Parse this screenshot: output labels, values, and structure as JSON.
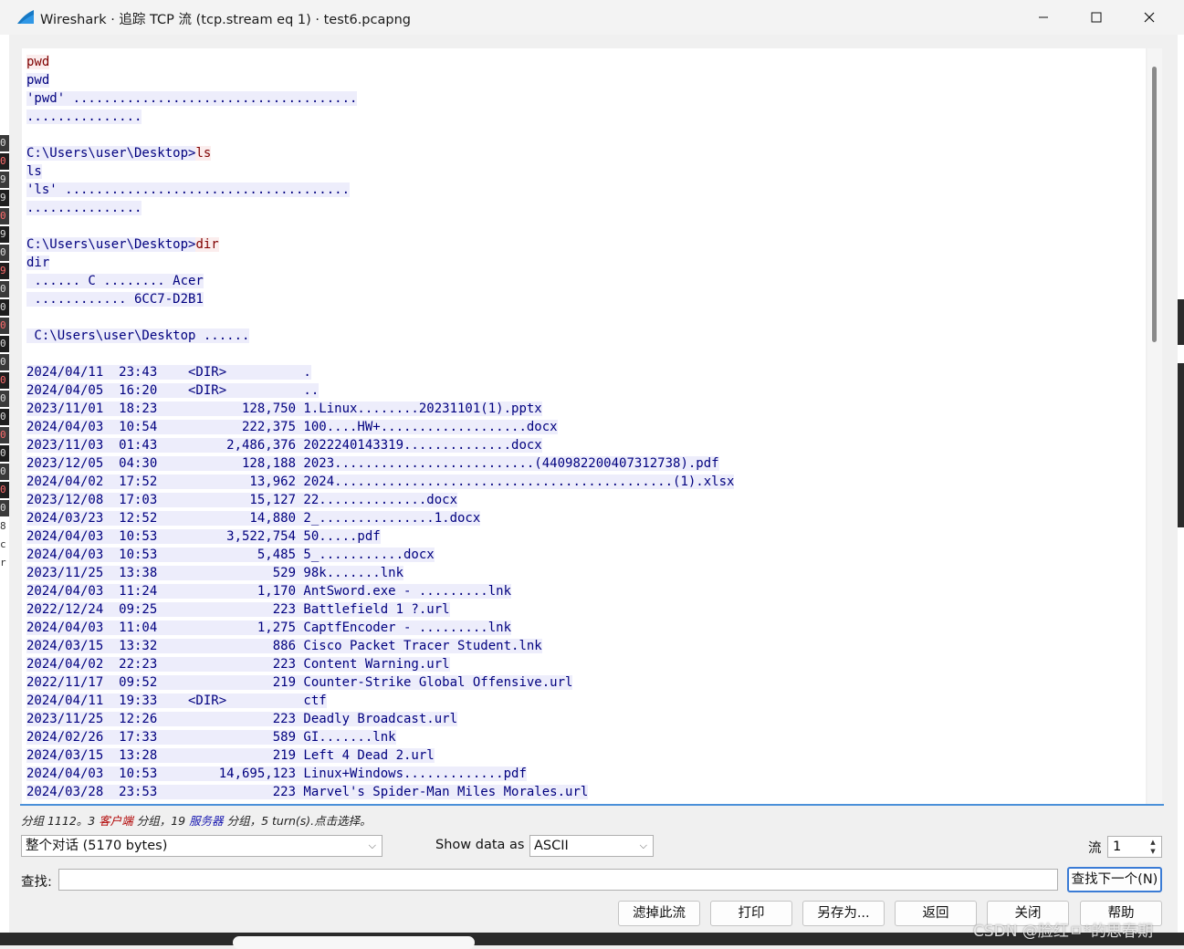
{
  "window": {
    "title": "Wireshark · 追踪 TCP 流 (tcp.stream eq 1) · test6.pcapng",
    "minimize_glyph": "—",
    "maximize_glyph": "☐",
    "close_glyph": "✕",
    "icon": "wireshark-fin-icon"
  },
  "colors": {
    "client_bg": "#fbeded",
    "client_fg": "#7f0000",
    "server_bg": "#ededfb",
    "server_fg": "#00007f",
    "focus": "#3a7bd5"
  },
  "stream_lines": [
    [
      {
        "d": "c",
        "t": "pwd"
      }
    ],
    [
      {
        "d": "s",
        "t": "pwd"
      }
    ],
    [
      {
        "d": "s",
        "t": "'pwd' ....................................."
      }
    ],
    [
      {
        "d": "s",
        "t": "..............."
      }
    ],
    [],
    [
      {
        "d": "s",
        "t": "C:\\Users\\user\\Desktop>"
      },
      {
        "d": "c",
        "t": "ls"
      }
    ],
    [
      {
        "d": "s",
        "t": "ls"
      }
    ],
    [
      {
        "d": "s",
        "t": "'ls' ....................................."
      }
    ],
    [
      {
        "d": "s",
        "t": "..............."
      }
    ],
    [],
    [
      {
        "d": "s",
        "t": "C:\\Users\\user\\Desktop>"
      },
      {
        "d": "c",
        "t": "dir"
      }
    ],
    [
      {
        "d": "s",
        "t": "dir"
      }
    ],
    [
      {
        "d": "s",
        "t": " ...... C ........ Acer"
      }
    ],
    [
      {
        "d": "s",
        "t": " ............ 6CC7-D2B1"
      }
    ],
    [],
    [
      {
        "d": "s",
        "t": " C:\\Users\\user\\Desktop ......"
      }
    ],
    [],
    [
      {
        "d": "s",
        "t": "2024/04/11  23:43    <DIR>          ."
      }
    ],
    [
      {
        "d": "s",
        "t": "2024/04/05  16:20    <DIR>          .."
      }
    ],
    [
      {
        "d": "s",
        "t": "2023/11/01  18:23           128,750 1.Linux........20231101(1).pptx"
      }
    ],
    [
      {
        "d": "s",
        "t": "2024/04/03  10:54           222,375 100....HW+...................docx"
      }
    ],
    [
      {
        "d": "s",
        "t": "2023/11/03  01:43         2,486,376 2022240143319..............docx"
      }
    ],
    [
      {
        "d": "s",
        "t": "2023/12/05  04:30           128,188 2023..........................(440982200407312738).pdf"
      }
    ],
    [
      {
        "d": "s",
        "t": "2024/04/02  17:52            13,962 2024............................................(1).xlsx"
      }
    ],
    [
      {
        "d": "s",
        "t": "2023/12/08  17:03            15,127 22..............docx"
      }
    ],
    [
      {
        "d": "s",
        "t": "2024/03/23  12:52            14,880 2_...............1.docx"
      }
    ],
    [
      {
        "d": "s",
        "t": "2024/04/03  10:53         3,522,754 50.....pdf"
      }
    ],
    [
      {
        "d": "s",
        "t": "2024/04/03  10:53             5,485 5_...........docx"
      }
    ],
    [
      {
        "d": "s",
        "t": "2023/11/25  13:38               529 98k.......lnk"
      }
    ],
    [
      {
        "d": "s",
        "t": "2024/04/03  11:24             1,170 AntSword.exe - .........lnk"
      }
    ],
    [
      {
        "d": "s",
        "t": "2022/12/24  09:25               223 Battlefield 1 ?.url"
      }
    ],
    [
      {
        "d": "s",
        "t": "2024/04/03  11:04             1,275 CaptfEncoder - .........lnk"
      }
    ],
    [
      {
        "d": "s",
        "t": "2024/03/15  13:32               886 Cisco Packet Tracer Student.lnk"
      }
    ],
    [
      {
        "d": "s",
        "t": "2024/04/02  22:23               223 Content Warning.url"
      }
    ],
    [
      {
        "d": "s",
        "t": "2022/11/17  09:52               219 Counter-Strike Global Offensive.url"
      }
    ],
    [
      {
        "d": "s",
        "t": "2024/04/11  19:33    <DIR>          ctf"
      }
    ],
    [
      {
        "d": "s",
        "t": "2023/11/25  12:26               223 Deadly Broadcast.url"
      }
    ],
    [
      {
        "d": "s",
        "t": "2024/02/26  17:33               589 GI.......lnk"
      }
    ],
    [
      {
        "d": "s",
        "t": "2024/03/15  13:28               219 Left 4 Dead 2.url"
      }
    ],
    [
      {
        "d": "s",
        "t": "2024/04/03  10:53        14,695,123 Linux+Windows.............pdf"
      }
    ],
    [
      {
        "d": "s",
        "t": "2024/03/28  23:53               223 Marvel's Spider-Man Miles Morales.url"
      }
    ]
  ],
  "status": {
    "prefix": "分组 1112。3 ",
    "client_word": "客户端",
    "mid": " 分组，19 ",
    "server_word": "服务器",
    "suffix": " 分组，5 turn(s).点击选择。"
  },
  "controls": {
    "conversation_select": "整个对话  (5170 bytes)",
    "show_data_label": "Show data as",
    "show_data_value": "ASCII",
    "stream_label": "流",
    "stream_value": "1",
    "find_label": "查找:",
    "find_value": "",
    "find_next_button": "查找下一个(N)"
  },
  "buttons": {
    "filter_out": "滤掉此流",
    "print": "打印",
    "save_as": "另存为...",
    "back": "返回",
    "close": "关闭",
    "help": "帮助"
  },
  "left_strip_chars": [
    "0",
    "0",
    "9",
    "9",
    "0",
    "9",
    "0",
    "9",
    "0",
    "0",
    "0",
    "0",
    "0",
    "0",
    "0",
    "0",
    "0",
    "0",
    "0",
    "0",
    "0",
    "8",
    "c",
    "r"
  ],
  "watermark": "CSDN @脸红ㅁ*的思春期"
}
